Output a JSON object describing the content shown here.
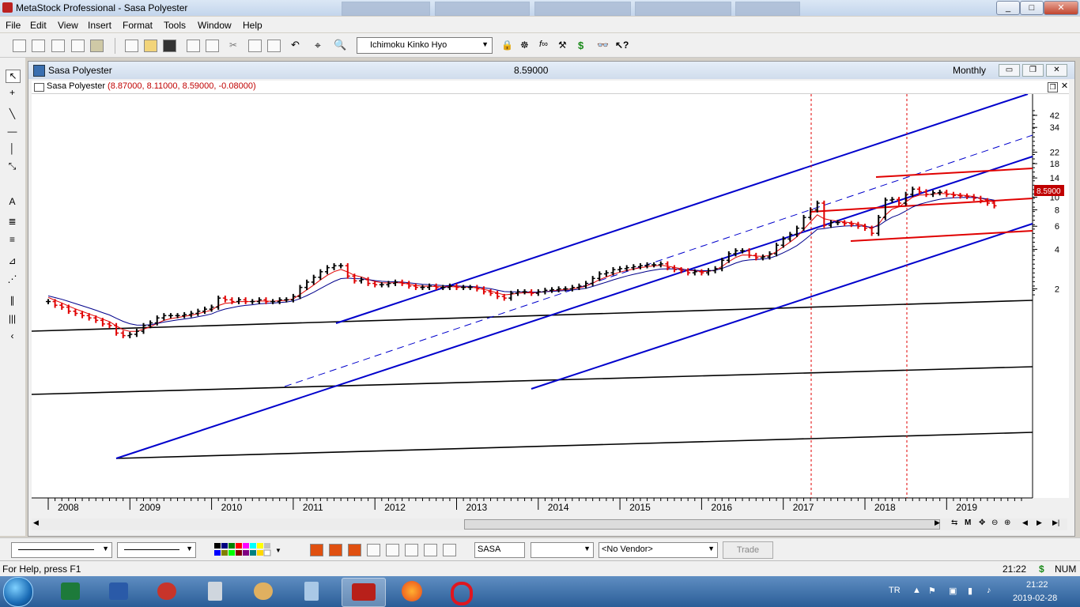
{
  "window": {
    "title": "MetaStock Professional - Sasa Polyester",
    "controls": [
      "_",
      "□",
      "✕"
    ]
  },
  "menu": [
    "File",
    "Edit",
    "View",
    "Insert",
    "Format",
    "Tools",
    "Window",
    "Help"
  ],
  "toolbar": {
    "template": "Ichimoku Kinko Hyo"
  },
  "chart_window": {
    "title": "Sasa Polyester",
    "last_price": "8.59000",
    "periodicity": "Monthly",
    "legend_name": "Sasa Polyester",
    "legend_values": "(8.87000, 8.11000, 8.59000, -0.08000)",
    "price_marker": "8.5900"
  },
  "chart_data": {
    "type": "bar",
    "scale": "log",
    "y_ticks": [
      2,
      4,
      6,
      8,
      10,
      14,
      18,
      22,
      34,
      42
    ],
    "x_labels": [
      "2008",
      "2009",
      "2010",
      "2011",
      "2012",
      "2013",
      "2014",
      "2015",
      "2016",
      "2017",
      "2018",
      "2019"
    ],
    "last_close": 8.59,
    "monthly_close": [
      1.6,
      1.5,
      1.45,
      1.35,
      1.3,
      1.25,
      1.2,
      1.15,
      1.08,
      1.05,
      0.92,
      0.88,
      0.9,
      0.95,
      1.05,
      1.1,
      1.2,
      1.25,
      1.25,
      1.25,
      1.27,
      1.3,
      1.35,
      1.4,
      1.45,
      1.7,
      1.65,
      1.6,
      1.65,
      1.6,
      1.6,
      1.65,
      1.6,
      1.6,
      1.65,
      1.65,
      1.75,
      2.05,
      2.25,
      2.45,
      2.7,
      2.9,
      3.0,
      3.0,
      2.5,
      2.3,
      2.35,
      2.2,
      2.15,
      2.15,
      2.2,
      2.25,
      2.2,
      2.1,
      2.05,
      2.05,
      2.1,
      2.05,
      2.05,
      2.1,
      2.05,
      2.05,
      2.05,
      2.0,
      1.9,
      1.85,
      1.75,
      1.7,
      1.85,
      1.9,
      1.9,
      1.85,
      1.9,
      1.95,
      1.97,
      2.0,
      2.0,
      2.05,
      2.1,
      2.2,
      2.4,
      2.6,
      2.65,
      2.8,
      2.85,
      2.9,
      2.95,
      3.0,
      3.05,
      3.05,
      3.1,
      2.9,
      2.8,
      2.75,
      2.65,
      2.7,
      2.65,
      2.75,
      2.85,
      3.3,
      3.7,
      3.9,
      3.9,
      3.6,
      3.45,
      3.5,
      3.7,
      4.3,
      4.8,
      5.2,
      5.8,
      7.0,
      8.0,
      9.0,
      6.1,
      6.4,
      6.4,
      6.3,
      6.2,
      6.0,
      5.8,
      5.3,
      7.0,
      9.5,
      9.6,
      9.0,
      10.5,
      11.5,
      11.0,
      10.5,
      10.8,
      10.9,
      10.5,
      10.3,
      10.2,
      10.1,
      9.8,
      9.4,
      9.0,
      8.59
    ]
  },
  "drawbar": {
    "symbol": "SASA",
    "vendor": "<No Vendor>",
    "trade": "Trade"
  },
  "status": {
    "help": "For Help, press F1",
    "time": "21:22",
    "currency": "$",
    "num": "NUM"
  },
  "taskbar": {
    "lang": "TR",
    "clock_time": "21:22",
    "clock_date": "2019-02-28"
  }
}
